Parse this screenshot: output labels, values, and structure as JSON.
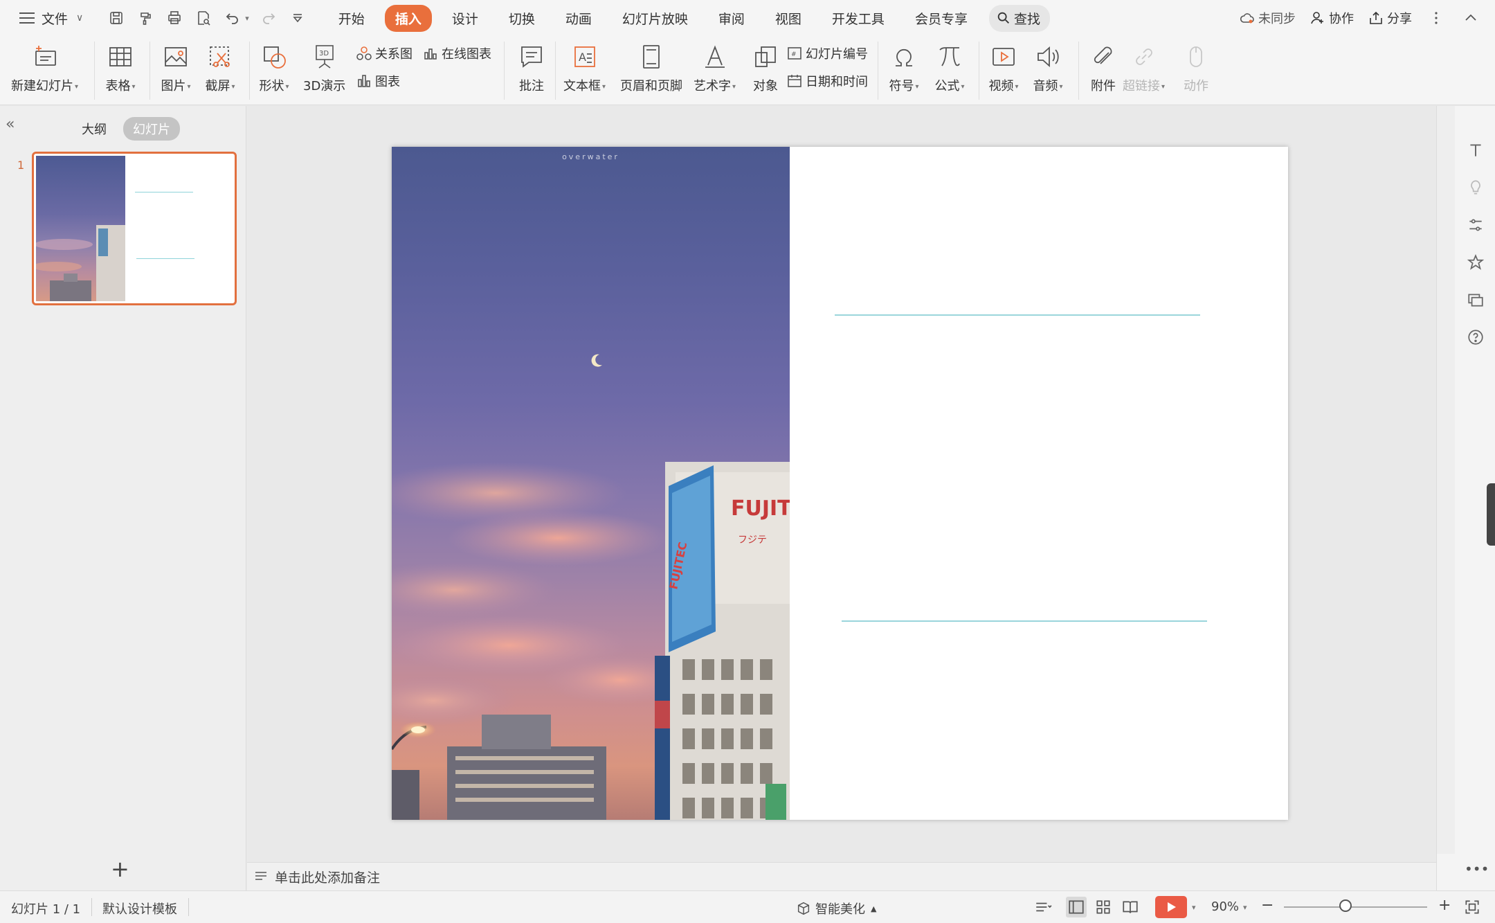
{
  "menubar": {
    "file_label": "文件",
    "tabs": [
      {
        "label": "开始"
      },
      {
        "label": "插入",
        "active": true
      },
      {
        "label": "设计"
      },
      {
        "label": "切换"
      },
      {
        "label": "动画"
      },
      {
        "label": "幻灯片放映"
      },
      {
        "label": "审阅"
      },
      {
        "label": "视图"
      },
      {
        "label": "开发工具"
      },
      {
        "label": "会员专享"
      }
    ],
    "search_label": "查找",
    "sync_label": "未同步",
    "collab_label": "协作",
    "share_label": "分享",
    "accent_color": "#e96f3c"
  },
  "ribbon": {
    "new_slide": "新建幻灯片",
    "table": "表格",
    "picture": "图片",
    "screenshot": "截屏",
    "shape": "形状",
    "demo3d": "3D演示",
    "relation": "关系图",
    "online_chart": "在线图表",
    "chart": "图表",
    "comment": "批注",
    "textbox": "文本框",
    "header_footer": "页眉和页脚",
    "wordart": "艺术字",
    "object": "对象",
    "slide_number": "幻灯片编号",
    "datetime": "日期和时间",
    "symbol": "符号",
    "formula": "公式",
    "video": "视频",
    "audio": "音频",
    "attachment": "附件",
    "hyperlink": "超链接",
    "action": "动作"
  },
  "leftpanel": {
    "tab_outline": "大纲",
    "tab_slides": "幻灯片",
    "slide_number": "1"
  },
  "slide": {
    "photo_caption": "overwater"
  },
  "notes": {
    "placeholder": "单击此处添加备注"
  },
  "statusbar": {
    "slide_info": "幻灯片 1 / 1",
    "template": "默认设计模板",
    "beautify": "智能美化",
    "zoom": "90%"
  }
}
